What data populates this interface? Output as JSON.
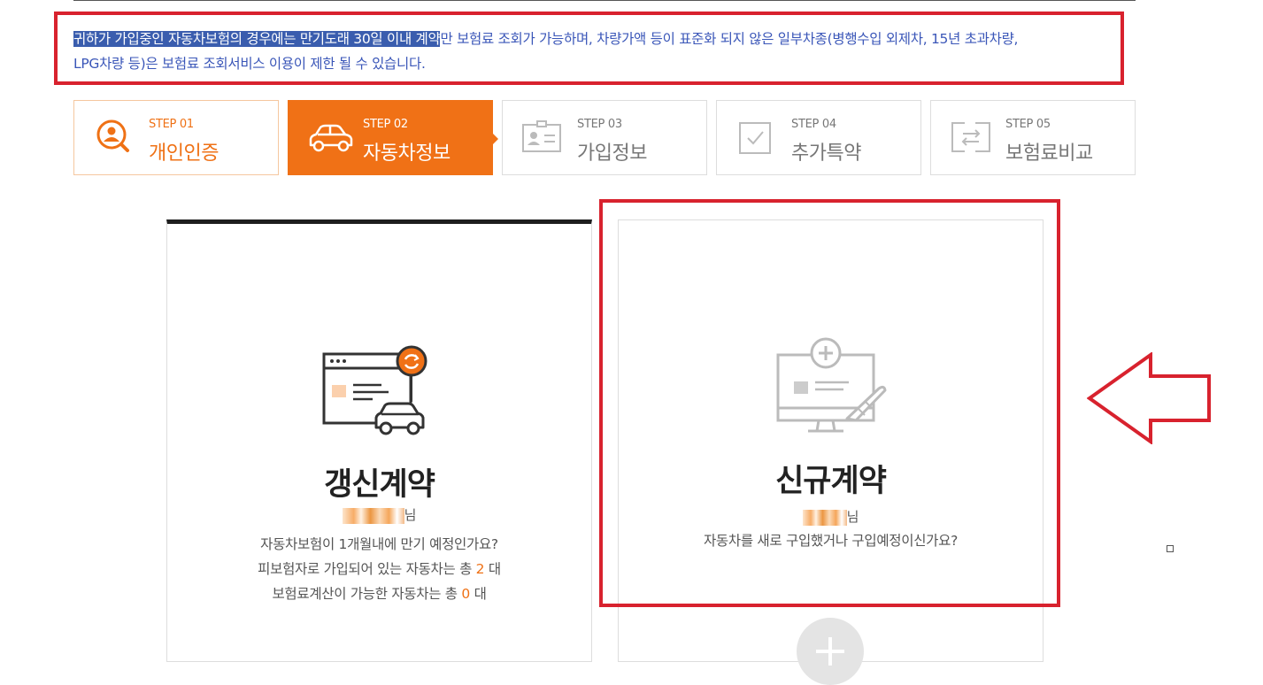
{
  "notice": {
    "highlighted": "귀하가 가입중인 자동차보험의 경우에는 만기도래 30일 이내 계약",
    "rest_line1": "만 보험료 조회가 가능하며, 차량가액 등이 표준화 되지 않은 일부차종(병행수입 외제차, 15년 초과차량,",
    "line2": "LPG차량 등)은 보험료 조회서비스 이용이 제한 될 수 있습니다."
  },
  "steps": [
    {
      "num": "STEP 01",
      "name": "개인인증",
      "icon": "person-search-icon",
      "state": "done"
    },
    {
      "num": "STEP 02",
      "name": "자동차정보",
      "icon": "car-icon",
      "state": "active"
    },
    {
      "num": "STEP 03",
      "name": "가입정보",
      "icon": "id-card-icon",
      "state": "inactive"
    },
    {
      "num": "STEP 04",
      "name": "추가특약",
      "icon": "checkbox-icon",
      "state": "inactive"
    },
    {
      "num": "STEP 05",
      "name": "보험료비교",
      "icon": "compare-arrows-icon",
      "state": "inactive"
    }
  ],
  "renewal": {
    "title": "갱신계약",
    "name_suffix": "님",
    "line1": "자동차보험이 1개월내에 만기 예정인가요?",
    "line2_prefix": "피보험자로 가입되어 있는 자동차는 총 ",
    "line2_count": "2",
    "line2_suffix": " 대",
    "line3_prefix": "보험료계산이 가능한 자동차는 총 ",
    "line3_count": "0",
    "line3_suffix": " 대"
  },
  "new_contract": {
    "title": "신규계약",
    "name_suffix": "님",
    "line1": "자동차를 새로 구입했거나 구입예정이신가요?"
  },
  "colors": {
    "accent": "#f07116",
    "highlight_box": "#d8222e",
    "notice_text": "#3a56b8"
  }
}
